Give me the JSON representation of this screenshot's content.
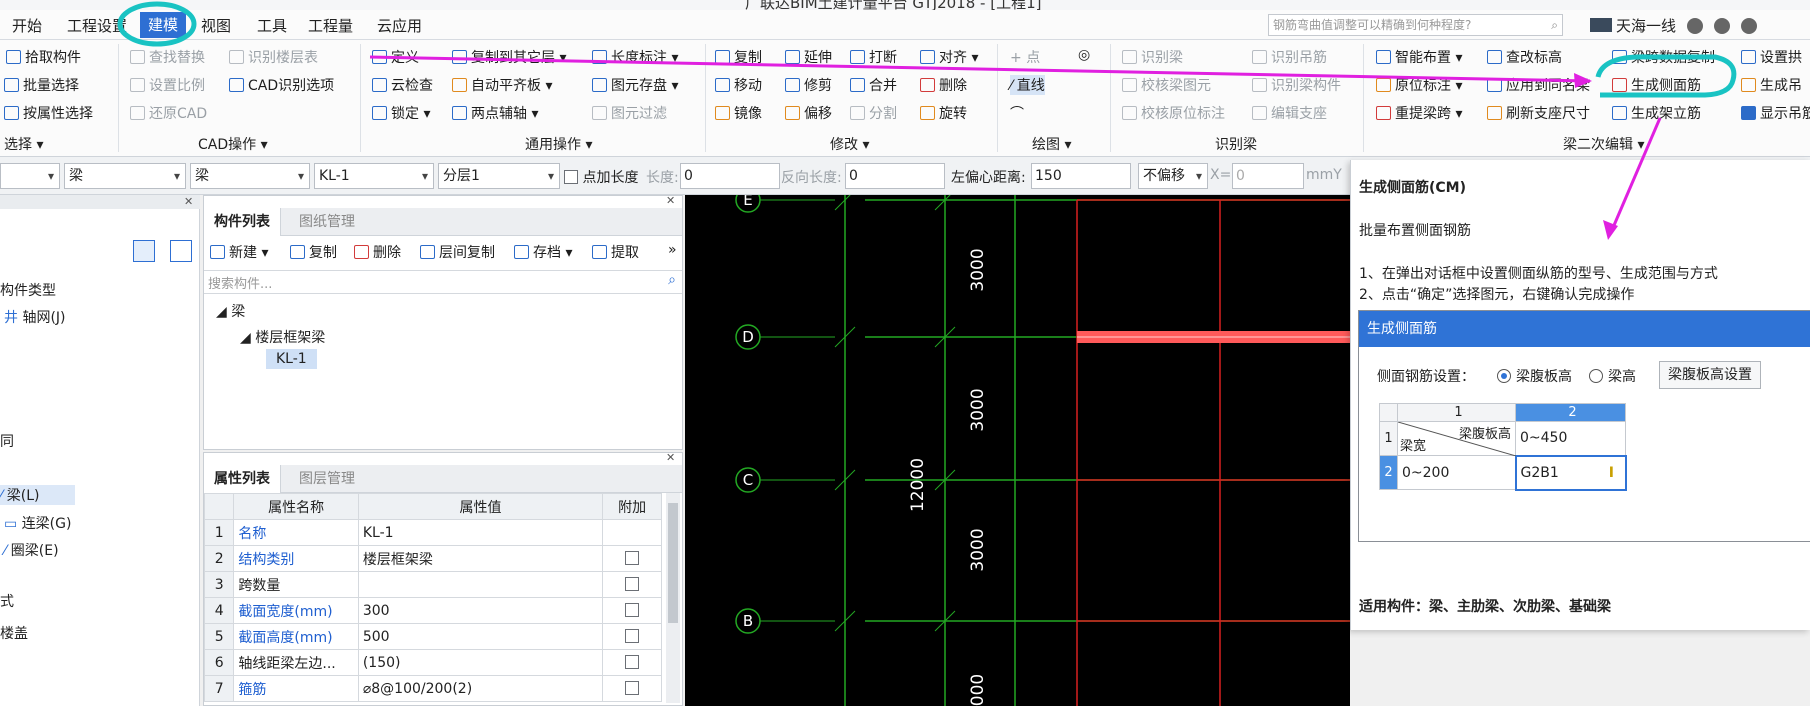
{
  "app": {
    "title": "广联达BIM土建计量平台 GTJ2018 - [工程1]"
  },
  "menu": {
    "items": [
      "开始",
      "工程设置",
      "建模",
      "视图",
      "工具",
      "工程量",
      "云应用"
    ],
    "active": "建模",
    "search_placeholder": "钢筋弯曲值调整可以精确到何种程度?",
    "user": "天海一线"
  },
  "ribbon": {
    "select": {
      "pick": "拾取构件",
      "batch": "批量选择",
      "by_attr": "按属性选择",
      "label": "选择"
    },
    "cad": {
      "find_replace": "查找替换",
      "identify_floor": "识别楼层表",
      "set_scale": "设置比例",
      "cad_identify": "CAD识别选项",
      "restore": "还原CAD",
      "label": "CAD操作"
    },
    "general": {
      "define": "定义",
      "copy_floor": "复制到其它层",
      "length_dim": "长度标注",
      "cloud_check": "云检查",
      "auto_align": "自动平齐板",
      "store": "图元存盘",
      "lock": "锁定",
      "two_point_axis": "两点辅轴",
      "filter": "图元过滤",
      "label": "通用操作"
    },
    "modify": {
      "copy": "复制",
      "extend": "延伸",
      "break": "打断",
      "align": "对齐",
      "move": "移动",
      "trim": "修剪",
      "merge": "合并",
      "delete": "删除",
      "mirror": "镜像",
      "offset": "偏移",
      "split": "分割",
      "rotate": "旋转",
      "label": "修改"
    },
    "draw": {
      "point": "点",
      "line": "直线",
      "label": "绘图"
    },
    "identify": {
      "identify_beam": "识别梁",
      "identify_hanger": "识别吊筋",
      "check_beam": "校核梁图元",
      "identify_support": "识别梁构件",
      "check_pos": "校核原位标注",
      "edit_support": "编辑支座",
      "label": "识别梁"
    },
    "second": {
      "smart_layout": "智能布置",
      "check_mark": "查改标高",
      "span_copy": "梁跨数据复制",
      "set_arch": "设置拱",
      "pos_mark": "原位标注",
      "apply_same": "应用到同名梁",
      "gen_side": "生成侧面筋",
      "gen_hanger": "生成吊",
      "re_span": "重提梁跨",
      "refresh_support": "刷新支座尺寸",
      "gen_stirrup": "生成架立筋",
      "show_hanger": "显示吊筋",
      "label": "梁二次编辑"
    }
  },
  "propbar": {
    "dd1": "",
    "dd2": "梁",
    "dd3": "梁",
    "dd4": "KL-1",
    "dd5": "分层1",
    "add_length": "点加长度",
    "length": "长度:",
    "length_val": "0",
    "rev_length": "反向长度:",
    "rev_val": "0",
    "left_offset": "左偏心距离:",
    "left_val": "150",
    "no_offset": "不偏移",
    "x_label": "X=",
    "x_val": "0",
    "unit": "mmY"
  },
  "leftpane": {
    "items": [
      "构件类型",
      "轴网(J)",
      "同",
      "梁(L)",
      "连梁(G)",
      "圈梁(E)",
      "式",
      "楼盖"
    ]
  },
  "comppane": {
    "tab1": "构件列表",
    "tab2": "图纸管理",
    "new": "新建",
    "copy": "复制",
    "delete": "删除",
    "floor_copy": "层间复制",
    "save": "存档",
    "extract": "提取",
    "search_placeholder": "搜索构件...",
    "tree_root": "梁",
    "tree_child": "楼层框架梁",
    "tree_leaf": "KL-1"
  },
  "proppane": {
    "tab1": "属性列表",
    "tab2": "图层管理",
    "headers": [
      "属性名称",
      "属性值",
      "附加"
    ],
    "rows": [
      {
        "n": "1",
        "name": "名称",
        "value": "KL-1",
        "blue": true,
        "check": false
      },
      {
        "n": "2",
        "name": "结构类别",
        "value": "楼层框架梁",
        "blue": true,
        "check": true
      },
      {
        "n": "3",
        "name": "跨数量",
        "value": "",
        "blue": false,
        "check": true
      },
      {
        "n": "4",
        "name": "截面宽度(mm)",
        "value": "300",
        "blue": true,
        "check": true
      },
      {
        "n": "5",
        "name": "截面高度(mm)",
        "value": "500",
        "blue": true,
        "check": true
      },
      {
        "n": "6",
        "name": "轴线距梁左边...",
        "value": "(150)",
        "blue": false,
        "check": true
      },
      {
        "n": "7",
        "name": "箍筋",
        "value": "⌀8@100/200(2)",
        "blue": true,
        "check": true
      }
    ]
  },
  "canvas": {
    "axes": [
      "E",
      "D",
      "C",
      "B"
    ],
    "dims": [
      "3000",
      "3000",
      "3000",
      "000"
    ],
    "total": "12000"
  },
  "tip": {
    "title": "生成侧面筋(CM)",
    "subtitle": "批量布置侧面钢筋",
    "step1": "1、在弹出对话框中设置侧面纵筋的型号、生成范围与方式",
    "step2": "2、点击“确定”选择图元，右键确认完成操作",
    "dialog_title": "生成侧面筋",
    "setting_label": "侧面钢筋设置：",
    "opt1": "梁腹板高",
    "opt2": "梁高",
    "btn": "梁腹板高设置",
    "col1": "1",
    "col2": "2",
    "h_top": "梁腹板高",
    "h_bottom": "梁宽",
    "r1n": "1",
    "r1c2": "0~450",
    "r2n": "2",
    "r2c1": "0~200",
    "r2c2": "G2B1",
    "footer": "适用构件：梁、主肋梁、次肋梁、基础梁"
  },
  "colors": {
    "accent": "#2e6fd3",
    "annotation_magenta": "#e020e0",
    "annotation_cyan": "#19c3c3",
    "grid_green": "#23a823",
    "grid_red": "#d82020",
    "beam_red": "#ff5a5a"
  }
}
